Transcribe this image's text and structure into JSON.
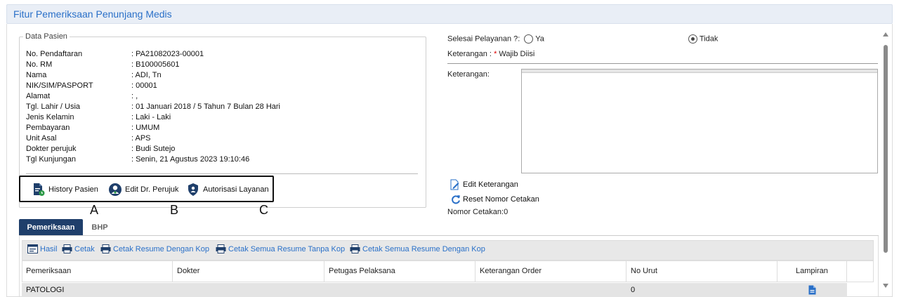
{
  "header": {
    "title": "Fitur Pemeriksaan Penunjang Medis"
  },
  "pasien": {
    "legend": "Data Pasien",
    "fields": [
      {
        "label": "No. Pendaftaran",
        "value": ": PA21082023-00001"
      },
      {
        "label": "No. RM",
        "value": ": B100005601"
      },
      {
        "label": "Nama",
        "value": ": ADI, Tn"
      },
      {
        "label": "NIK/SIM/PASPORT",
        "value": ": 00001"
      },
      {
        "label": "Alamat",
        "value": ": ,"
      },
      {
        "label": "Tgl. Lahir / Usia",
        "value": ": 01 Januari 2018 / 5 Tahun 7 Bulan 28 Hari"
      },
      {
        "label": "Jenis Kelamin",
        "value": ": Laki - Laki"
      },
      {
        "label": "Pembayaran",
        "value": ": UMUM"
      },
      {
        "label": "Unit Asal",
        "value": ": APS"
      },
      {
        "label": "Dokter perujuk",
        "value": ": Budi Sutejo"
      },
      {
        "label": "Tgl Kunjungan",
        "value": ": Senin, 21 Agustus 2023 19:10:46"
      }
    ],
    "actions": {
      "history": "History Pasien",
      "edit_dr": "Edit Dr. Perujuk",
      "otorisasi": "Autorisasi Layanan"
    },
    "markers": {
      "a": "A",
      "b": "B",
      "c": "C"
    }
  },
  "right": {
    "selesai_label": "Selesai Pelayanan ?:",
    "opt_ya": "Ya",
    "opt_tidak": "Tidak",
    "keterangan_note_prefix": "Keterangan : ",
    "required_mark": "*",
    "keterangan_note_suffix": " Wajib Diisi",
    "keterangan_label": "Keterangan:",
    "edit_keterangan": "Edit Keterangan",
    "reset_nomor": "Reset Nomor Cetakan",
    "nomor_cetakan": "Nomor Cetakan:0"
  },
  "tabs": {
    "pemeriksaan": "Pemeriksaan",
    "bhp": "BHP"
  },
  "toolbar": {
    "hasil": "Hasil",
    "cetak": "Cetak",
    "cetak_resume_kop": "Cetak Resume Dengan Kop",
    "cetak_semua_tanpa_kop": "Cetak Semua Resume Tanpa Kop",
    "cetak_semua_kop": "Cetak Semua Resume Dengan Kop"
  },
  "grid": {
    "columns": [
      "Pemeriksaan",
      "Dokter",
      "Petugas Pelaksana",
      "Keterangan Order",
      "No Urut",
      "Lampiran"
    ],
    "rows": [
      {
        "pemeriksaan": "PATOLOGI",
        "dokter": "",
        "petugas": "",
        "keterangan": "",
        "no_urut": "0"
      }
    ]
  },
  "colors": {
    "accent": "#2a70c8",
    "tab_active": "#1f3f6b",
    "icon_navy": "#1f3f6b",
    "icon_green": "#2e9a48"
  }
}
